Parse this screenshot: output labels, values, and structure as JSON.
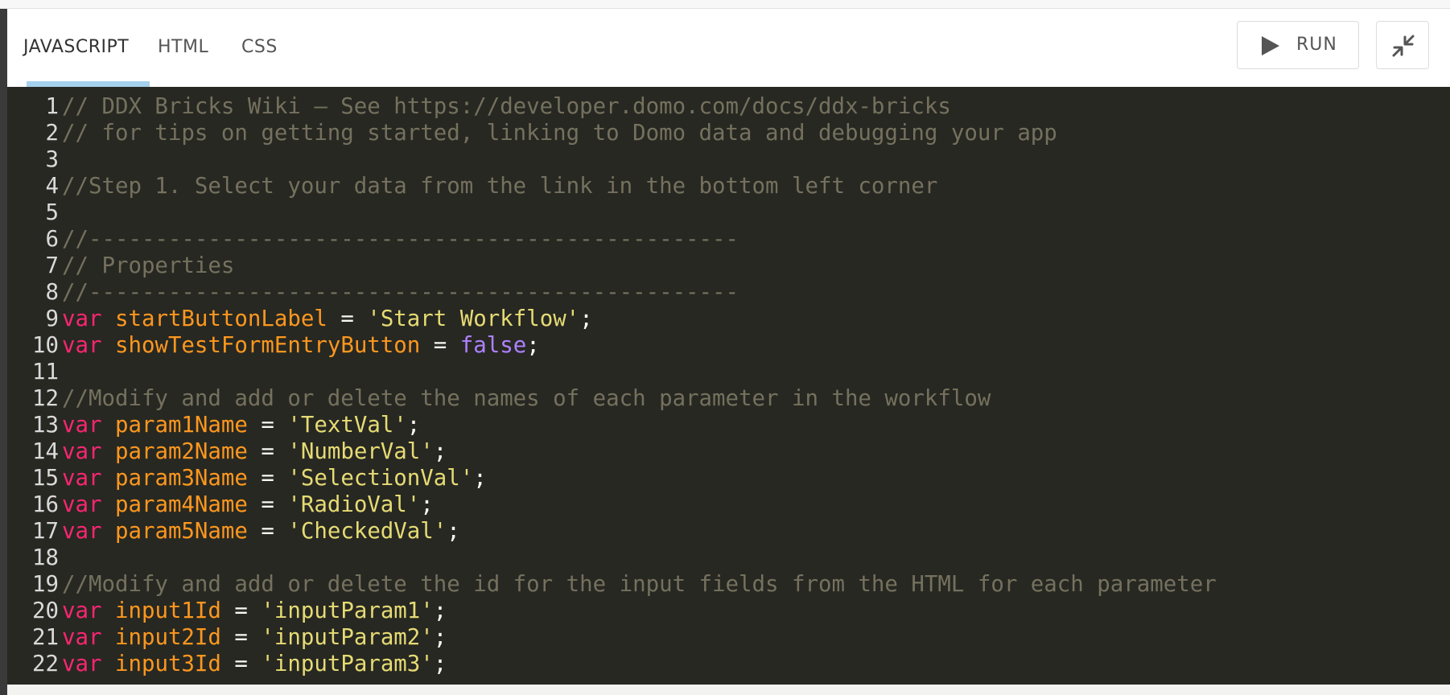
{
  "tabs": [
    {
      "label": "JAVASCRIPT",
      "active": true
    },
    {
      "label": "HTML",
      "active": false
    },
    {
      "label": "CSS",
      "active": false
    }
  ],
  "toolbar": {
    "run_label": "RUN",
    "run_icon": "play-icon",
    "collapse_icon": "collapse-arrows-icon"
  },
  "colors": {
    "tab_underline": "#a5d1ee",
    "editor_bg": "#272822",
    "comment": "#75715e",
    "keyword": "#f92672",
    "variable": "#fd971f",
    "string": "#e6db74",
    "boolean": "#ae81ff"
  },
  "editor": {
    "lines": [
      {
        "n": "1",
        "tokens": [
          [
            "comment",
            "// DDX Bricks Wiki – See https://developer.domo.com/docs/ddx-bricks"
          ]
        ]
      },
      {
        "n": "2",
        "tokens": [
          [
            "comment",
            "// for tips on getting started, linking to Domo data and debugging your app"
          ]
        ]
      },
      {
        "n": "3",
        "tokens": []
      },
      {
        "n": "4",
        "tokens": [
          [
            "comment",
            "//Step 1. Select your data from the link in the bottom left corner"
          ]
        ]
      },
      {
        "n": "5",
        "tokens": []
      },
      {
        "n": "6",
        "tokens": [
          [
            "comment",
            "//-------------------------------------------------"
          ]
        ]
      },
      {
        "n": "7",
        "tokens": [
          [
            "comment",
            "// Properties"
          ]
        ]
      },
      {
        "n": "8",
        "tokens": [
          [
            "comment",
            "//-------------------------------------------------"
          ]
        ]
      },
      {
        "n": "9",
        "tokens": [
          [
            "keyword",
            "var"
          ],
          [
            "plain",
            " "
          ],
          [
            "var",
            "startButtonLabel"
          ],
          [
            "plain",
            " = "
          ],
          [
            "string",
            "'Start Workflow'"
          ],
          [
            "plain",
            ";"
          ]
        ]
      },
      {
        "n": "10",
        "tokens": [
          [
            "keyword",
            "var"
          ],
          [
            "plain",
            " "
          ],
          [
            "var",
            "showTestFormEntryButton"
          ],
          [
            "plain",
            " = "
          ],
          [
            "bool",
            "false"
          ],
          [
            "plain",
            ";"
          ]
        ]
      },
      {
        "n": "11",
        "tokens": []
      },
      {
        "n": "12",
        "tokens": [
          [
            "comment",
            "//Modify and add or delete the names of each parameter in the workflow"
          ]
        ]
      },
      {
        "n": "13",
        "tokens": [
          [
            "keyword",
            "var"
          ],
          [
            "plain",
            " "
          ],
          [
            "var",
            "param1Name"
          ],
          [
            "plain",
            " = "
          ],
          [
            "string",
            "'TextVal'"
          ],
          [
            "plain",
            ";"
          ]
        ]
      },
      {
        "n": "14",
        "tokens": [
          [
            "keyword",
            "var"
          ],
          [
            "plain",
            " "
          ],
          [
            "var",
            "param2Name"
          ],
          [
            "plain",
            " = "
          ],
          [
            "string",
            "'NumberVal'"
          ],
          [
            "plain",
            ";"
          ]
        ]
      },
      {
        "n": "15",
        "tokens": [
          [
            "keyword",
            "var"
          ],
          [
            "plain",
            " "
          ],
          [
            "var",
            "param3Name"
          ],
          [
            "plain",
            " = "
          ],
          [
            "string",
            "'SelectionVal'"
          ],
          [
            "plain",
            ";"
          ]
        ]
      },
      {
        "n": "16",
        "tokens": [
          [
            "keyword",
            "var"
          ],
          [
            "plain",
            " "
          ],
          [
            "var",
            "param4Name"
          ],
          [
            "plain",
            " = "
          ],
          [
            "string",
            "'RadioVal'"
          ],
          [
            "plain",
            ";"
          ]
        ]
      },
      {
        "n": "17",
        "tokens": [
          [
            "keyword",
            "var"
          ],
          [
            "plain",
            " "
          ],
          [
            "var",
            "param5Name"
          ],
          [
            "plain",
            " = "
          ],
          [
            "string",
            "'CheckedVal'"
          ],
          [
            "plain",
            ";"
          ]
        ]
      },
      {
        "n": "18",
        "tokens": []
      },
      {
        "n": "19",
        "tokens": [
          [
            "comment",
            "//Modify and add or delete the id for the input fields from the HTML for each parameter"
          ]
        ]
      },
      {
        "n": "20",
        "tokens": [
          [
            "keyword",
            "var"
          ],
          [
            "plain",
            " "
          ],
          [
            "var",
            "input1Id"
          ],
          [
            "plain",
            " = "
          ],
          [
            "string",
            "'inputParam1'"
          ],
          [
            "plain",
            ";"
          ]
        ]
      },
      {
        "n": "21",
        "tokens": [
          [
            "keyword",
            "var"
          ],
          [
            "plain",
            " "
          ],
          [
            "var",
            "input2Id"
          ],
          [
            "plain",
            " = "
          ],
          [
            "string",
            "'inputParam2'"
          ],
          [
            "plain",
            ";"
          ]
        ]
      },
      {
        "n": "22",
        "tokens": [
          [
            "keyword",
            "var"
          ],
          [
            "plain",
            " "
          ],
          [
            "var",
            "input3Id"
          ],
          [
            "plain",
            " = "
          ],
          [
            "string",
            "'inputParam3'"
          ],
          [
            "plain",
            ";"
          ]
        ]
      }
    ]
  }
}
